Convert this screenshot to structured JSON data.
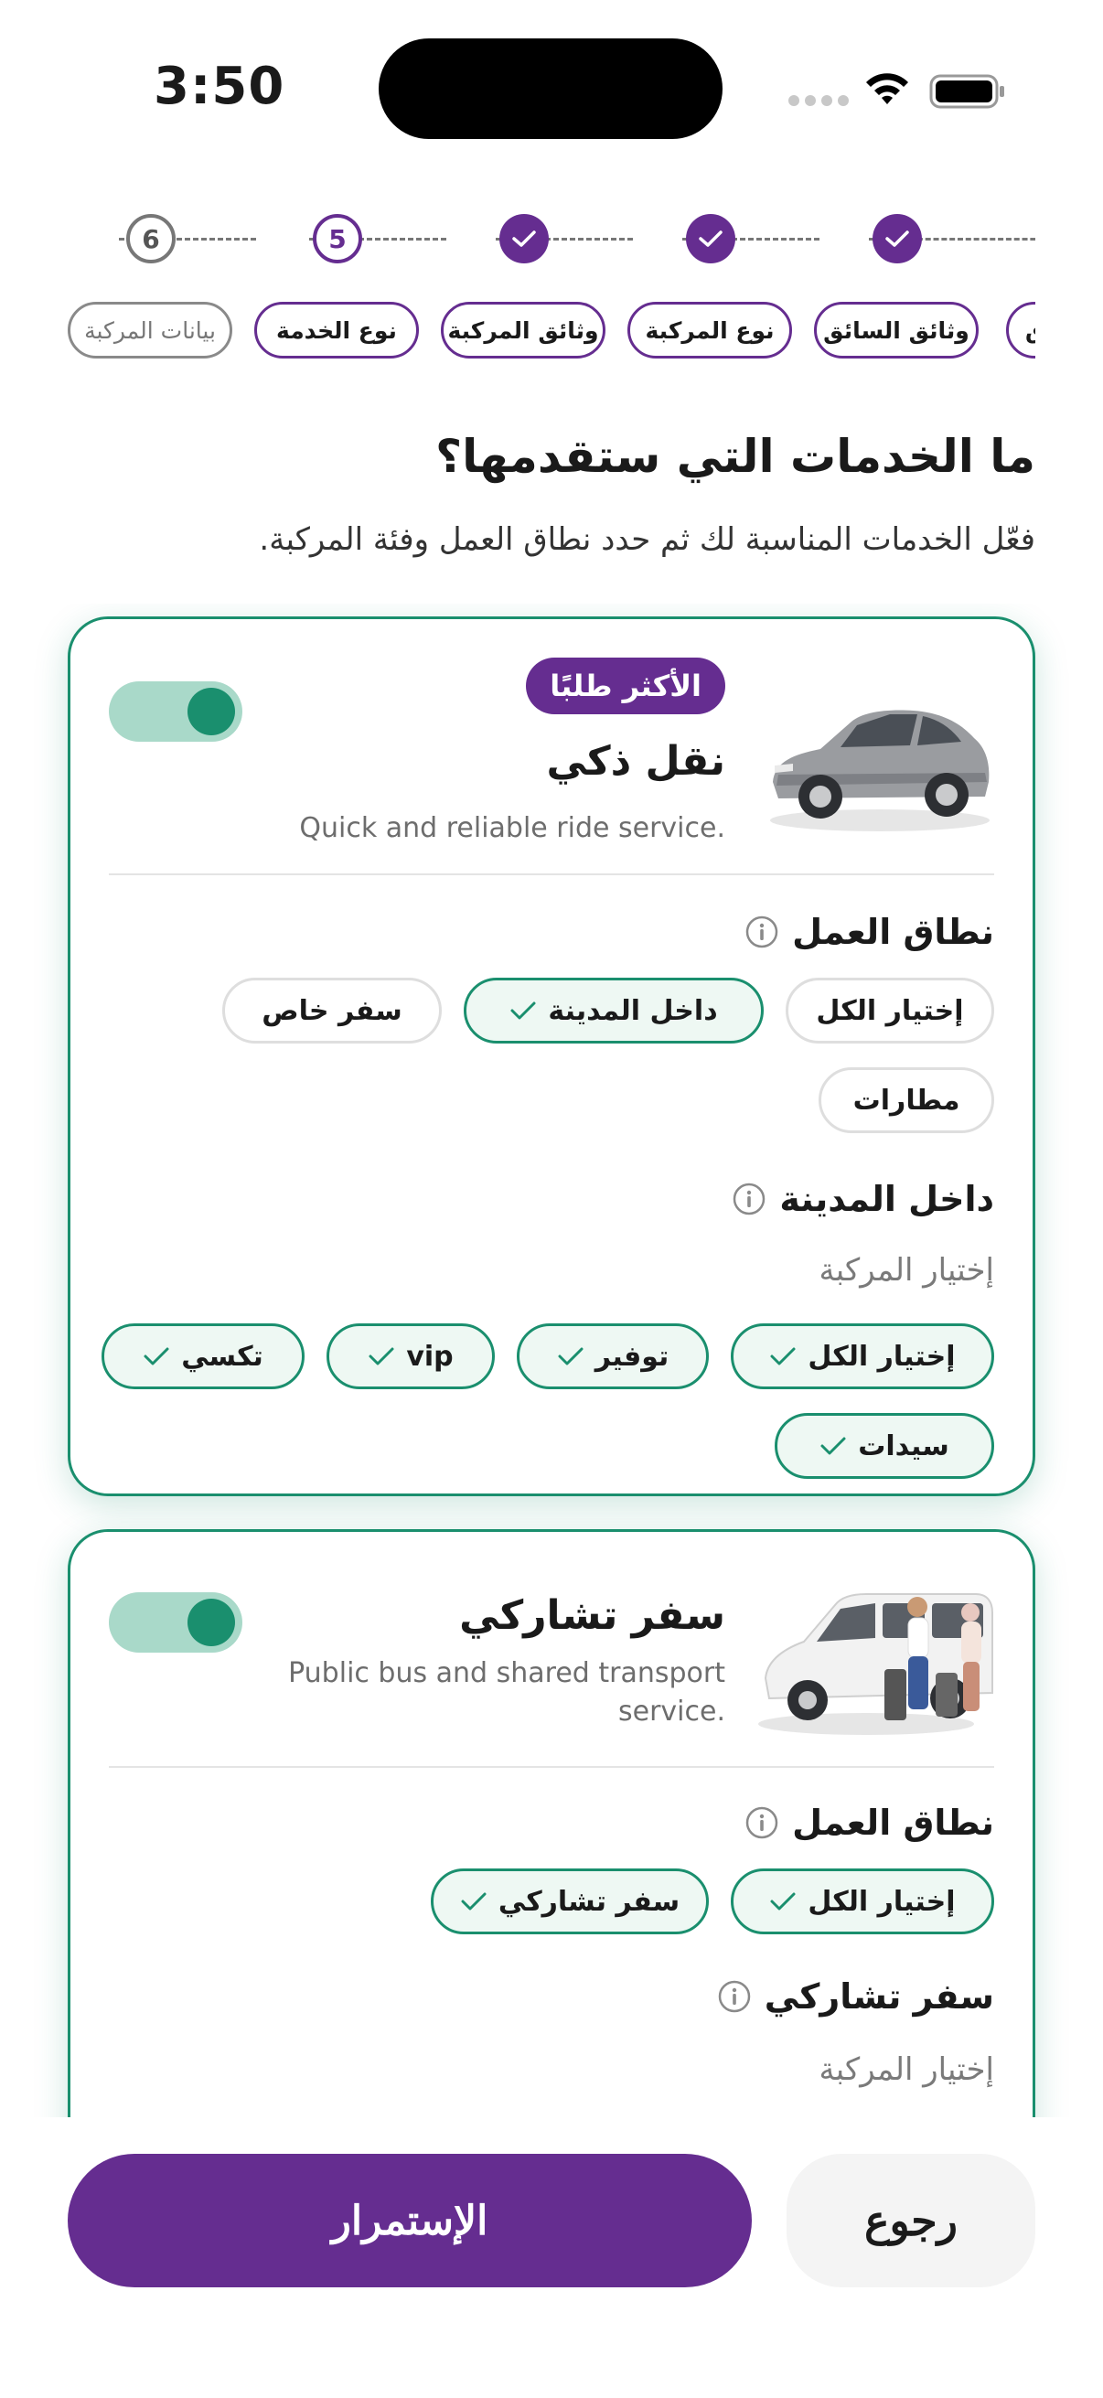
{
  "status_bar": {
    "time": "3:50"
  },
  "stepper": {
    "steps": [
      {
        "label": "6",
        "state": "todo"
      },
      {
        "label": "5",
        "state": "current"
      },
      {
        "label": "",
        "state": "done"
      },
      {
        "label": "",
        "state": "done"
      },
      {
        "label": "",
        "state": "done"
      }
    ],
    "chips": [
      {
        "label": "بيانات المركبة",
        "state": "inactive"
      },
      {
        "label": "نوع الخدمة",
        "state": "active"
      },
      {
        "label": "وثائق المركبة",
        "state": "active"
      },
      {
        "label": "نوع المركبة",
        "state": "active"
      },
      {
        "label": "وثائق السائق",
        "state": "active"
      },
      {
        "label": "ق",
        "state": "active"
      }
    ]
  },
  "header": {
    "title": "ما الخدمات التي ستقدمها؟",
    "subtitle": "فعّل الخدمات المناسبة لك ثم حدد نطاق العمل وفئة المركبة."
  },
  "services": [
    {
      "badge": "الأكثر طلبًا",
      "title": "نقل ذكي",
      "description": "Quick and reliable ride service.",
      "enabled": true,
      "scope_label": "نطاق العمل",
      "scope_chips": [
        {
          "label": "إختيار الكل",
          "selected": false
        },
        {
          "label": "داخل المدينة",
          "selected": true
        },
        {
          "label": "سفر خاص",
          "selected": false
        },
        {
          "label": "مطارات",
          "selected": false
        }
      ],
      "subsection_label": "داخل المدينة",
      "vehicle_prompt": "إختيار المركبة",
      "vehicle_chips": [
        {
          "label": "إختيار الكل",
          "selected": true
        },
        {
          "label": "توفير",
          "selected": true
        },
        {
          "label": "vip",
          "selected": true
        },
        {
          "label": "تكسي",
          "selected": true
        },
        {
          "label": "سيدات",
          "selected": true
        }
      ]
    },
    {
      "badge": "",
      "title": "سفر تشاركي",
      "description": "Public bus and shared transport service.",
      "enabled": true,
      "scope_label": "نطاق العمل",
      "scope_chips": [
        {
          "label": "إختيار الكل",
          "selected": true
        },
        {
          "label": "سفر تشاركي",
          "selected": true
        }
      ],
      "subsection_label": "سفر تشاركي",
      "vehicle_prompt": "إختيار المركبة"
    }
  ],
  "actions": {
    "continue_label": "الإستمرار",
    "back_label": "رجوع"
  },
  "colors": {
    "brand_purple": "#652d90",
    "accent_green": "#1a8f6e",
    "chip_selected_bg": "#eef8f3"
  }
}
